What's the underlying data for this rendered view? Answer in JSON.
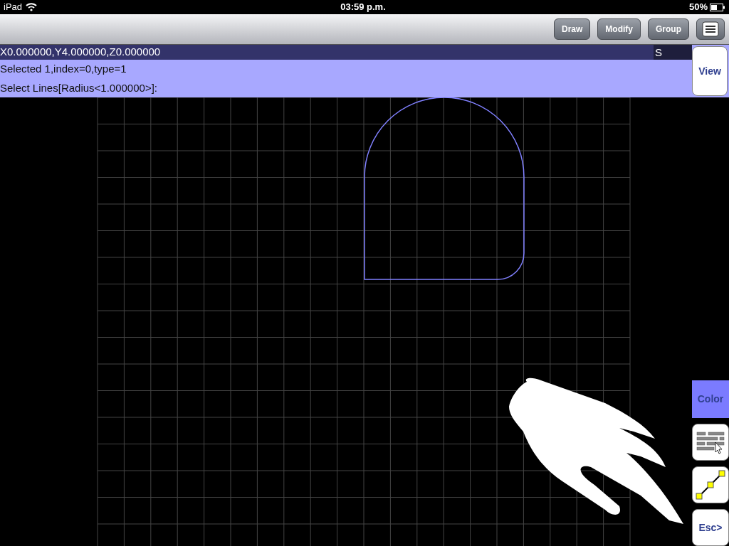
{
  "status_bar": {
    "device": "iPad",
    "time": "03:59 p.m.",
    "battery": "50%"
  },
  "toolbar": {
    "buttons": [
      "Draw",
      "Modify",
      "Group"
    ]
  },
  "coordinates": {
    "text": "X0.000000,Y4.000000,Z0.000000",
    "mode": "S"
  },
  "messages": [
    "Selected 1,index=0,type=1",
    "Select Lines[Radius<1.000000>]:"
  ],
  "view_button": "View",
  "side_buttons": [
    {
      "kind": "color",
      "label": "Color"
    },
    {
      "kind": "layers"
    },
    {
      "kind": "line"
    },
    {
      "kind": "text",
      "label": "Esc>"
    }
  ]
}
